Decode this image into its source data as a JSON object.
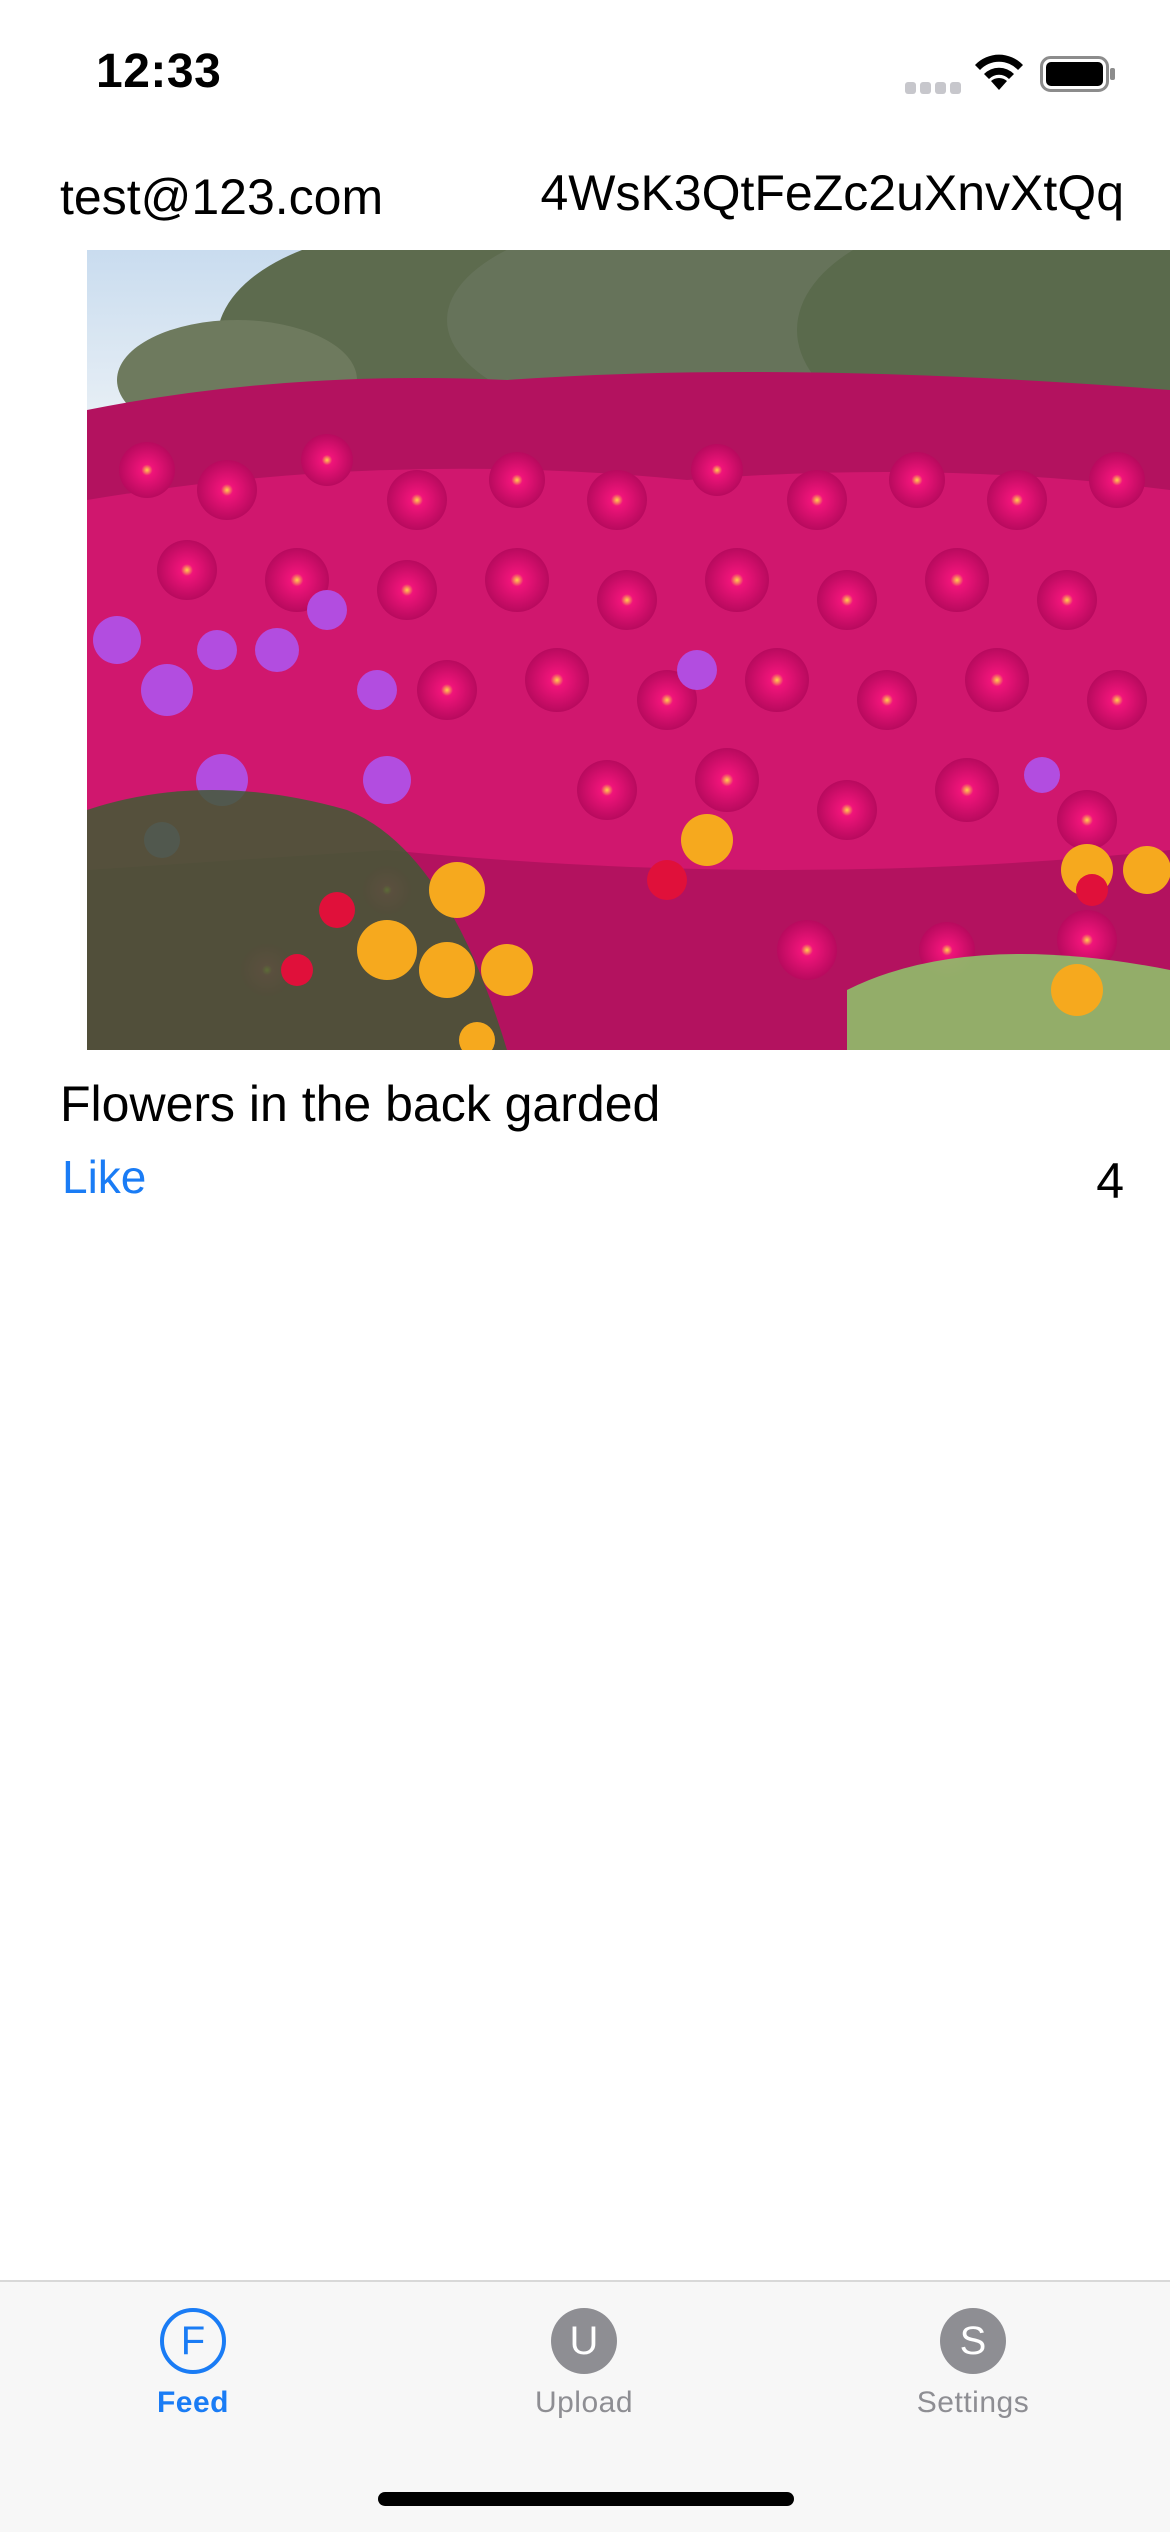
{
  "status_bar": {
    "time": "12:33"
  },
  "post": {
    "user_email": "test@123.com",
    "post_id": "4WsK3QtFeZc2uXnvXtQq",
    "caption": "Flowers in the back garded",
    "like_label": "Like",
    "like_count": "4"
  },
  "tab_bar": {
    "tabs": [
      {
        "icon_letter": "F",
        "label": "Feed"
      },
      {
        "icon_letter": "U",
        "label": "Upload"
      },
      {
        "icon_letter": "S",
        "label": "Settings"
      }
    ]
  },
  "colors": {
    "accent": "#1a7cf5",
    "inactive": "#8e8e93",
    "tab_bar_bg": "#f7f7f7"
  }
}
